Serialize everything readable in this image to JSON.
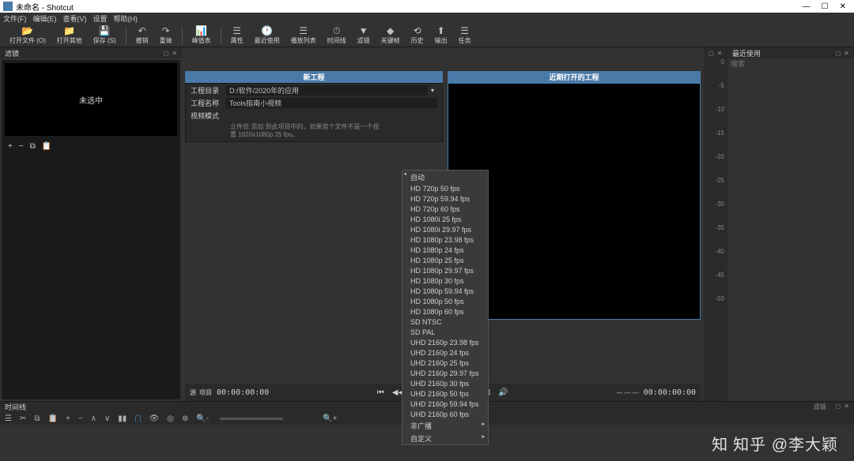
{
  "window": {
    "title": "未命名 - Shotcut",
    "min": "—",
    "max": "☐",
    "close": "✕"
  },
  "menu": {
    "file": "文件(F)",
    "edit": "编辑(E)",
    "view": "查看(V)",
    "settings": "设置",
    "help": "帮助(H)"
  },
  "toolbar": {
    "open": "打开文件 (O)",
    "openOther": "打开其他",
    "save": "保存 (S)",
    "undo": "撤销",
    "redo": "重做",
    "peakTable": "峰值表",
    "properties": "属性",
    "recent": "最近使用",
    "playlist": "播放列表",
    "timeline": "时间线",
    "filters": "滤镜",
    "keyframes": "关键帧",
    "history": "历史",
    "export": "输出",
    "jobs": "任务"
  },
  "sourcePanel": {
    "title": "滤镜",
    "notSelected": "未选中"
  },
  "newProject": {
    "title": "新工程",
    "dirLabel": "工程目录",
    "dirValue": "D:/软件/2020年的应用",
    "nameLabel": "工程名称",
    "nameValue": "Tools指南小视频",
    "modeLabel": "视频模式",
    "hint1": "立件您 添加 到此项目中的，如果首个文件不是一个视",
    "hint2": "置 1920x1080p 25 fps。"
  },
  "videoModes": [
    "自动",
    "HD 720p 50 fps",
    "HD 720p 59.94 fps",
    "HD 720p 60 fps",
    "HD 1080i 25 fps",
    "HD 1080i 29.97 fps",
    "HD 1080p 23.98 fps",
    "HD 1080p 24 fps",
    "HD 1080p 25 fps",
    "HD 1080p 29.97 fps",
    "HD 1080p 30 fps",
    "HD 1080p 59.94 fps",
    "HD 1080p 50 fps",
    "HD 1080p 60 fps",
    "SD NTSC",
    "SD PAL",
    "UHD 2160p 23.98 fps",
    "UHD 2160p 24 fps",
    "UHD 2160p 25 fps",
    "UHD 2160p 29.97 fps",
    "UHD 2160p 30 fps",
    "UHD 2160p 50 fps",
    "UHD 2160p 59.94 fps",
    "UHD 2160p 60 fps",
    "非广播",
    "自定义"
  ],
  "recentProjects": {
    "title": "近期打开的工程"
  },
  "rightPanel": {
    "recent": "最近使用",
    "search": "搜索"
  },
  "rulerTicks": [
    "0",
    "-5",
    "-10",
    "-15",
    "-20",
    "-25",
    "-30",
    "-35",
    "-40",
    "-45",
    "-50"
  ],
  "transport": {
    "tabSource": "源",
    "tabProject": "项目",
    "time": "00:00:00:00",
    "endTime": "00:00:00:00"
  },
  "timeline": {
    "title": "时间线",
    "filters": "滤镜"
  },
  "watermark": "知乎 @李大颖"
}
